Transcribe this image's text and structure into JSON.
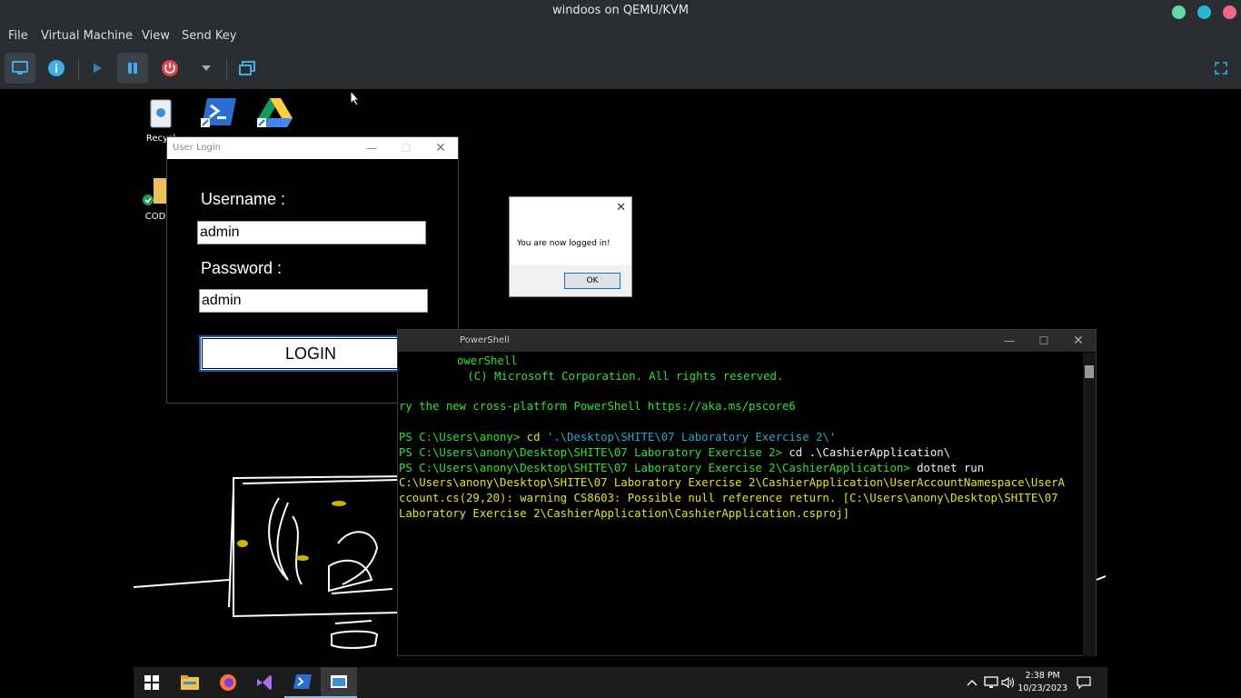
{
  "window": {
    "title": "windoos on QEMU/KVM"
  },
  "menu": [
    "File",
    "Virtual Machine",
    "View",
    "Send Key"
  ],
  "colors": {
    "dot_green": "#5ed9a6",
    "dot_cyan": "#2ab7d6",
    "dot_pink": "#f06886",
    "accent": "#0a61c0"
  },
  "desktop_icons": [
    {
      "label": "Recycl",
      "icon": "recycle-bin-icon"
    },
    {
      "label": "",
      "icon": "powershell-shortcut-icon"
    },
    {
      "label": "",
      "icon": "google-drive-icon"
    },
    {
      "label": "COD",
      "icon": "folder-icon"
    }
  ],
  "login": {
    "title": "User Login",
    "username_label": "Username :",
    "username_value": "admin",
    "password_label": "Password :",
    "password_value": "admin",
    "button": "LOGIN"
  },
  "msgbox": {
    "close": "✕",
    "text": "You are now logged in!",
    "ok": "OK"
  },
  "powershell": {
    "title": "PowerShell",
    "lines": [
      "owerShell",
      " (C) Microsoft Corporation. All rights reserved.",
      "",
      "ry the new cross-platform PowerShell https://aka.ms/pscore6",
      "",
      "PS C:\\Users\\anony> ",
      "PS C:\\Users\\anony\\Desktop\\SHITE\\07 Laboratory Exercise 2> ",
      "PS C:\\Users\\anony\\Desktop\\SHITE\\07 Laboratory Exercise 2\\CashierApplication> ",
      "C:\\Users\\anony\\Desktop\\SHITE\\07 Laboratory Exercise 2\\CashierApplication\\UserAccountNamespace\\UserA",
      "ccount.cs(29,20): warning CS8603: Possible null reference return. [C:\\Users\\anony\\Desktop\\SHITE\\07",
      "Laboratory Exercise 2\\CashierApplication\\CashierApplication.csproj]"
    ],
    "cmd1": "cd",
    "arg1": " '.\\Desktop\\SHITE\\07 Laboratory Exercise 2\\'",
    "cmd2": "cd .\\CashierApplication\\",
    "cmd3": "dotnet run"
  },
  "clock": {
    "time": "2:38 PM",
    "date": "10/23/2023"
  }
}
